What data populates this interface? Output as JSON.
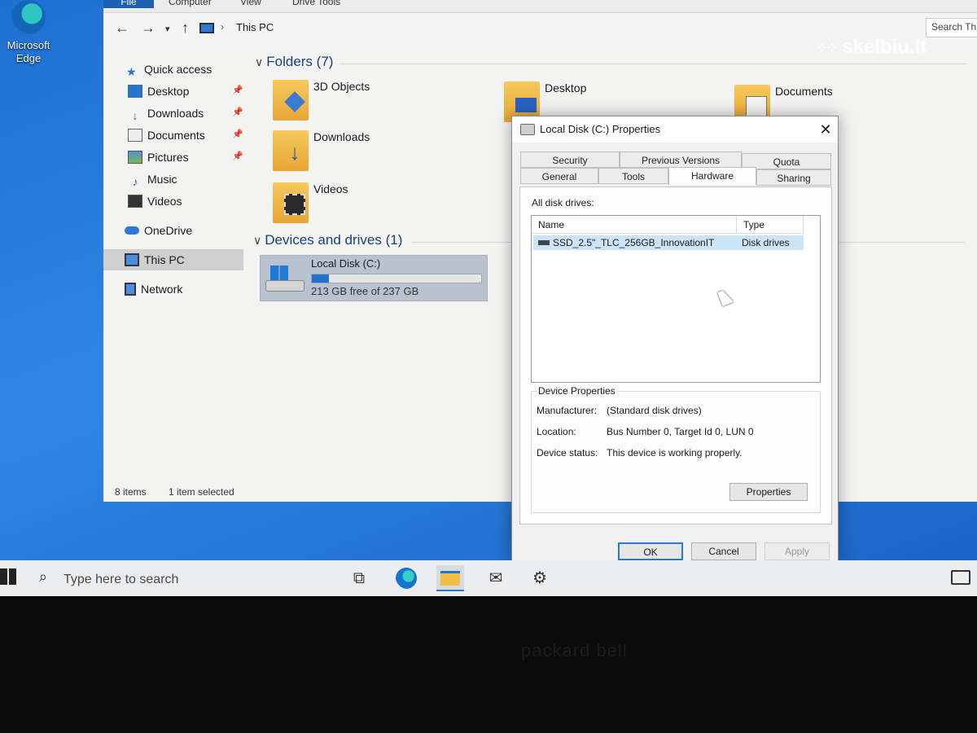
{
  "desktop": {
    "edge_shortcut_label": "Microsoft\nEdge"
  },
  "watermark": "skelbiu.lt",
  "explorer": {
    "ribbon_tabs": [
      "File",
      "Computer",
      "View",
      "Drive Tools"
    ],
    "breadcrumb": "This PC",
    "search_placeholder": "Search Th",
    "nav": {
      "quick_access": "Quick access",
      "items": [
        {
          "label": "Desktop",
          "pinned": true
        },
        {
          "label": "Downloads",
          "pinned": true
        },
        {
          "label": "Documents",
          "pinned": true
        },
        {
          "label": "Pictures",
          "pinned": true
        },
        {
          "label": "Music",
          "pinned": false
        },
        {
          "label": "Videos",
          "pinned": false
        }
      ],
      "onedrive": "OneDrive",
      "this_pc": "This PC",
      "network": "Network"
    },
    "folders_header": "Folders (7)",
    "folders": [
      "3D Objects",
      "Desktop",
      "Documents",
      "Downloads",
      "Videos"
    ],
    "devices_header": "Devices and drives (1)",
    "drive": {
      "name": "Local Disk (C:)",
      "free_text": "213 GB free of 237 GB",
      "used_fraction": 0.1
    },
    "status": {
      "items": "8 items",
      "selected": "1 item selected"
    }
  },
  "dialog": {
    "title": "Local Disk (C:) Properties",
    "tabs_row1": [
      "Security",
      "Previous Versions",
      "Quota"
    ],
    "tabs_row2": [
      "General",
      "Tools",
      "Hardware",
      "Sharing"
    ],
    "active_tab": "Hardware",
    "all_disk_drives": "All disk drives:",
    "columns": [
      "Name",
      "Type"
    ],
    "disk": {
      "name": "SSD_2.5\"_TLC_256GB_InnovationIT",
      "type": "Disk drives"
    },
    "device_properties_title": "Device Properties",
    "properties": [
      {
        "label": "Manufacturer:",
        "value": "(Standard disk drives)"
      },
      {
        "label": "Location:",
        "value": "Bus Number 0, Target Id 0, LUN 0"
      },
      {
        "label": "Device status:",
        "value": "This device is working properly."
      }
    ],
    "properties_button": "Properties",
    "buttons": {
      "ok": "OK",
      "cancel": "Cancel",
      "apply": "Apply"
    }
  },
  "taskbar": {
    "search_placeholder": "Type here to search"
  },
  "bezel_brand": "packard bell"
}
